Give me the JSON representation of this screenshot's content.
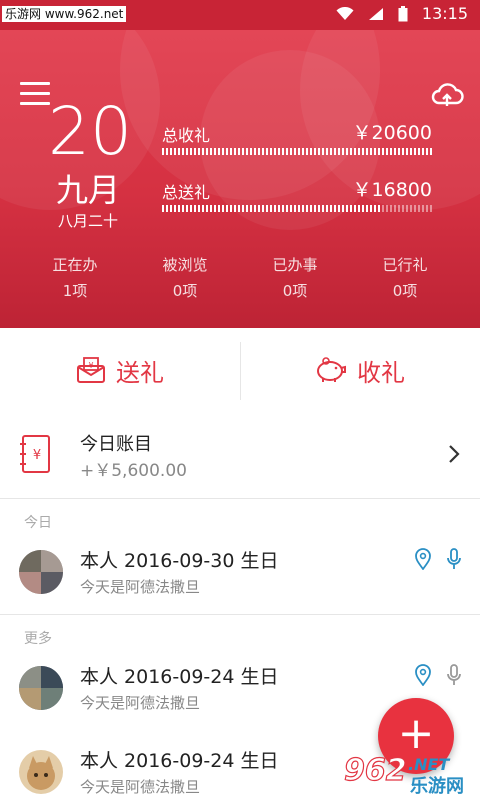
{
  "status_bar": {
    "watermark": "乐游网 www.962.net",
    "time": "13:15"
  },
  "header": {
    "day": "20",
    "month": "九月",
    "lunar_date": "八月二十",
    "total_received_label": "总收礼",
    "total_received_value": "￥20600",
    "total_sent_label": "总送礼",
    "total_sent_value": "￥16800",
    "sent_ratio": 0.8155,
    "stats": [
      {
        "label": "正在办",
        "value": "1项"
      },
      {
        "label": "被浏览",
        "value": "0项"
      },
      {
        "label": "已办事",
        "value": "0项"
      },
      {
        "label": "已行礼",
        "value": "0项"
      }
    ]
  },
  "actions": {
    "send_label": "送礼",
    "receive_label": "收礼"
  },
  "ledger": {
    "title": "今日账目",
    "amount": "+￥5,600.00"
  },
  "sections": {
    "today": "今日",
    "more": "更多"
  },
  "events": [
    {
      "title": "本人 2016-09-30 生日",
      "subtitle": "今天是阿德法撒旦"
    },
    {
      "title": "本人 2016-09-24 生日",
      "subtitle": "今天是阿德法撒旦"
    },
    {
      "title": "本人 2016-09-24 生日",
      "subtitle": "今天是阿德法撒旦"
    }
  ],
  "fab_label": "+",
  "brand_watermark": {
    "number": "962",
    "suffix": ".NET",
    "name": "乐游网"
  },
  "colors": {
    "accent": "#e23744",
    "header_red": "#d53142",
    "icon_blue": "#2a8fc4"
  }
}
